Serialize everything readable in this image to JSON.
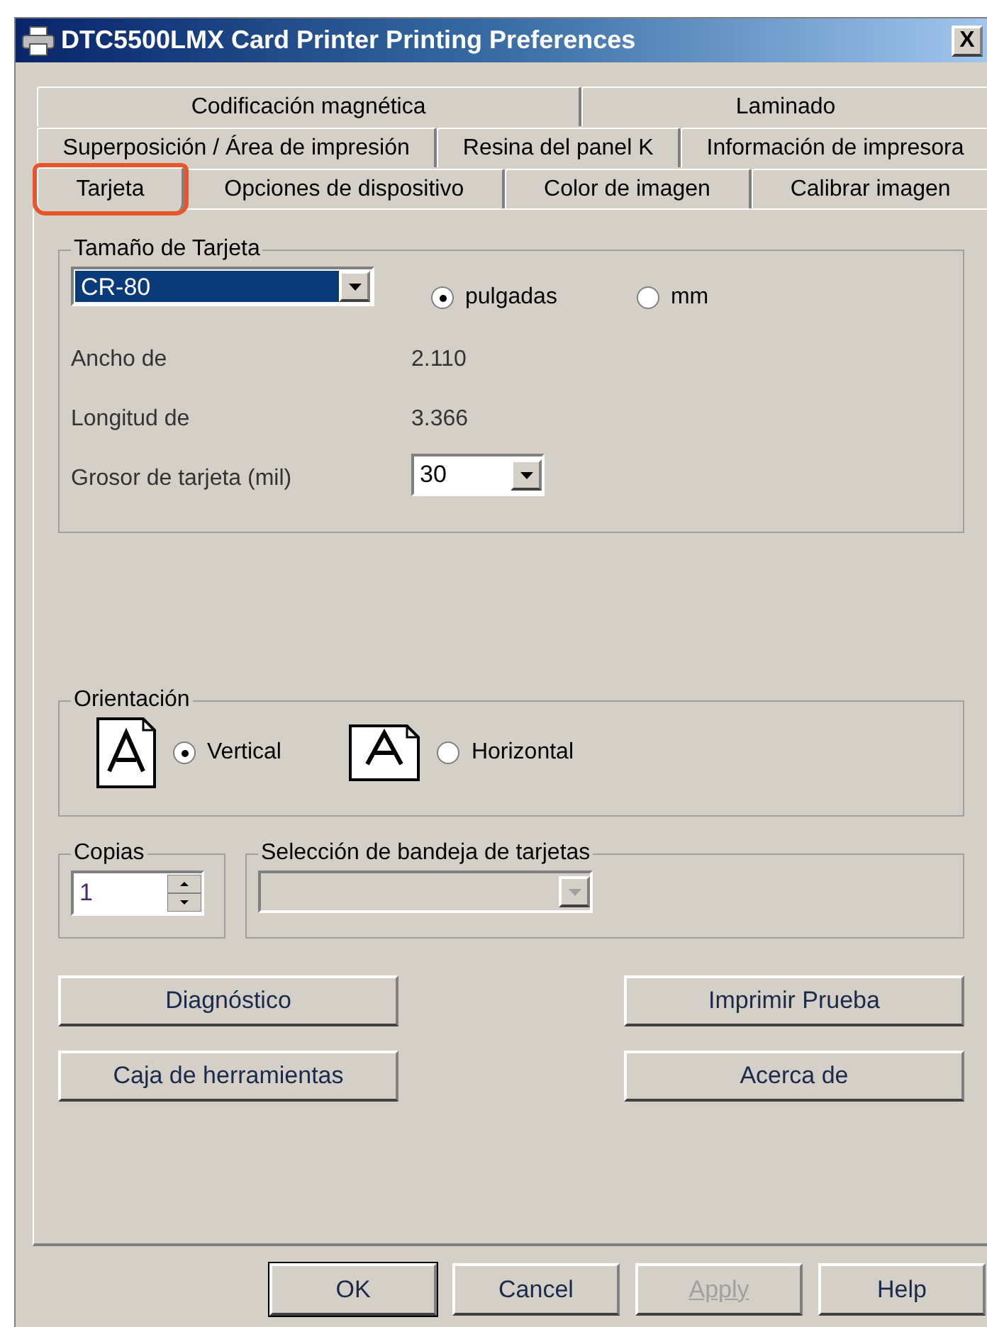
{
  "window": {
    "title": "DTC5500LMX Card Printer Printing Preferences",
    "close": "X"
  },
  "tab_rows": [
    [
      {
        "label": "Codificación magnética",
        "selected": false,
        "highlighted": false
      },
      {
        "label": "Laminado",
        "selected": false,
        "highlighted": false
      }
    ],
    [
      {
        "label": "Superposición / Área de impresión",
        "selected": false,
        "highlighted": false
      },
      {
        "label": "Resina del panel K",
        "selected": false,
        "highlighted": false
      },
      {
        "label": "Información de impresora",
        "selected": false,
        "highlighted": false
      }
    ],
    [
      {
        "label": "Tarjeta",
        "selected": true,
        "highlighted": true
      },
      {
        "label": "Opciones de dispositivo",
        "selected": false,
        "highlighted": false
      },
      {
        "label": "Color de imagen",
        "selected": false,
        "highlighted": false
      },
      {
        "label": "Calibrar imagen",
        "selected": false,
        "highlighted": false
      }
    ]
  ],
  "card_size": {
    "title": "Tamaño de Tarjeta",
    "size_value": "CR-80",
    "units": [
      {
        "label": "pulgadas",
        "selected": true
      },
      {
        "label": "mm",
        "selected": false
      }
    ],
    "width_label": "Ancho de",
    "width_value": "2.110",
    "length_label": "Longitud de",
    "length_value": "3.366",
    "thickness_label": "Grosor de tarjeta (mil)",
    "thickness_value": "30"
  },
  "orientation": {
    "title": "Orientación",
    "options": [
      {
        "label": "Vertical",
        "selected": true
      },
      {
        "label": "Horizontal",
        "selected": false
      }
    ]
  },
  "copies": {
    "title": "Copias",
    "value": "1"
  },
  "tray": {
    "title": "Selección de bandeja de tarjetas",
    "disabled": true
  },
  "action_buttons": [
    [
      "Diagnóstico",
      "Imprimir Prueba"
    ],
    [
      "Caja de herramientas",
      "Acerca de"
    ]
  ],
  "footer_buttons": [
    {
      "label": "OK",
      "disabled": false,
      "default": true
    },
    {
      "label": "Cancel",
      "disabled": false,
      "default": false
    },
    {
      "label": "Apply",
      "disabled": true,
      "default": false
    },
    {
      "label": "Help",
      "disabled": false,
      "default": false
    }
  ]
}
